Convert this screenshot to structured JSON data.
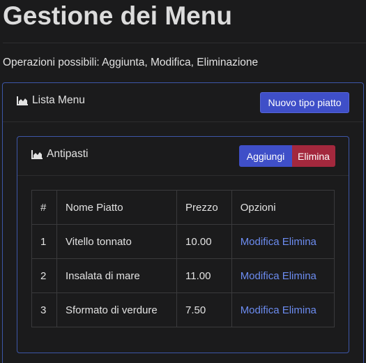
{
  "page": {
    "title": "Gestione dei Menu",
    "subtitle": "Operazioni possibili: Aggiunta, Modifica, Eliminazione"
  },
  "menu_card": {
    "icon": "chart-area-icon",
    "title": "Lista Menu",
    "new_type_button": "Nuovo tipo piatto"
  },
  "category": {
    "icon": "chart-area-icon",
    "title": "Antipasti",
    "add_button": "Aggiungi",
    "delete_button": "Elimina",
    "columns": [
      "#",
      "Nome Piatto",
      "Prezzo",
      "Opzioni"
    ],
    "rows": [
      {
        "num": "1",
        "name": "Vitello tonnato",
        "price": "10.00",
        "edit": "Modifica",
        "delete": "Elimina"
      },
      {
        "num": "2",
        "name": "Insalata di mare",
        "price": "11.00",
        "edit": "Modifica",
        "delete": "Elimina"
      },
      {
        "num": "3",
        "name": "Sformato di verdure",
        "price": "7.50",
        "edit": "Modifica",
        "delete": "Elimina"
      }
    ]
  },
  "colors": {
    "background": "#1b1b1c",
    "primary": "#3f4fc8",
    "danger": "#a3283d",
    "link": "#6c8cf0",
    "card_border": "#3d56a8"
  }
}
